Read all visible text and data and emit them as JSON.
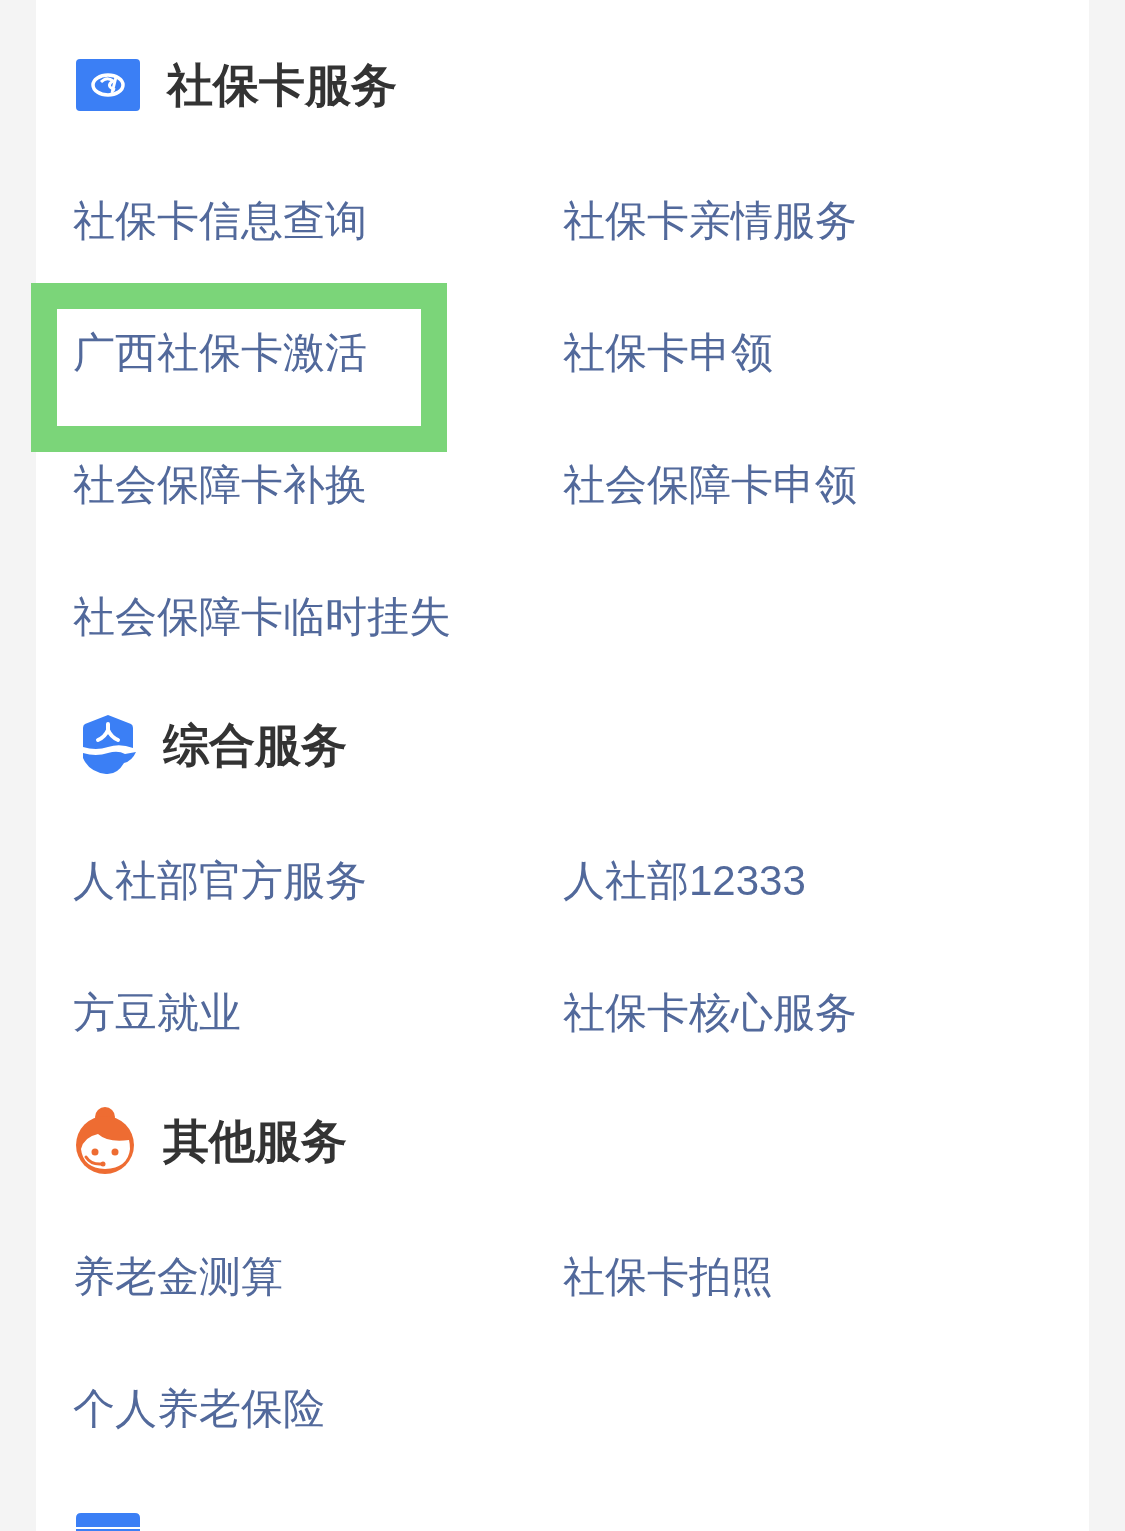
{
  "sections": [
    {
      "kind": "logo",
      "title": "社保卡服务",
      "items": [
        {
          "label": "社保卡信息查询",
          "highlighted": false
        },
        {
          "label": "社保卡亲情服务",
          "highlighted": false
        },
        {
          "label": "广西社保卡激活",
          "highlighted": true
        },
        {
          "label": "社保卡申领",
          "highlighted": false
        },
        {
          "label": "社会保障卡补换",
          "highlighted": false
        },
        {
          "label": "社会保障卡申领",
          "highlighted": false
        },
        {
          "label": "社会保障卡临时挂失",
          "highlighted": false
        }
      ]
    },
    {
      "kind": "shield",
      "title": "综合服务",
      "items": [
        {
          "label": "人社部官方服务",
          "highlighted": false
        },
        {
          "label": "人社部12333",
          "highlighted": false
        },
        {
          "label": "方豆就业",
          "highlighted": false
        },
        {
          "label": "社保卡核心服务",
          "highlighted": false
        }
      ]
    },
    {
      "kind": "agent",
      "title": "其他服务",
      "items": [
        {
          "label": "养老金测算",
          "highlighted": false
        },
        {
          "label": "社保卡拍照",
          "highlighted": false
        },
        {
          "label": "个人养老保险",
          "highlighted": false
        }
      ]
    },
    {
      "kind": "card"
    }
  ]
}
